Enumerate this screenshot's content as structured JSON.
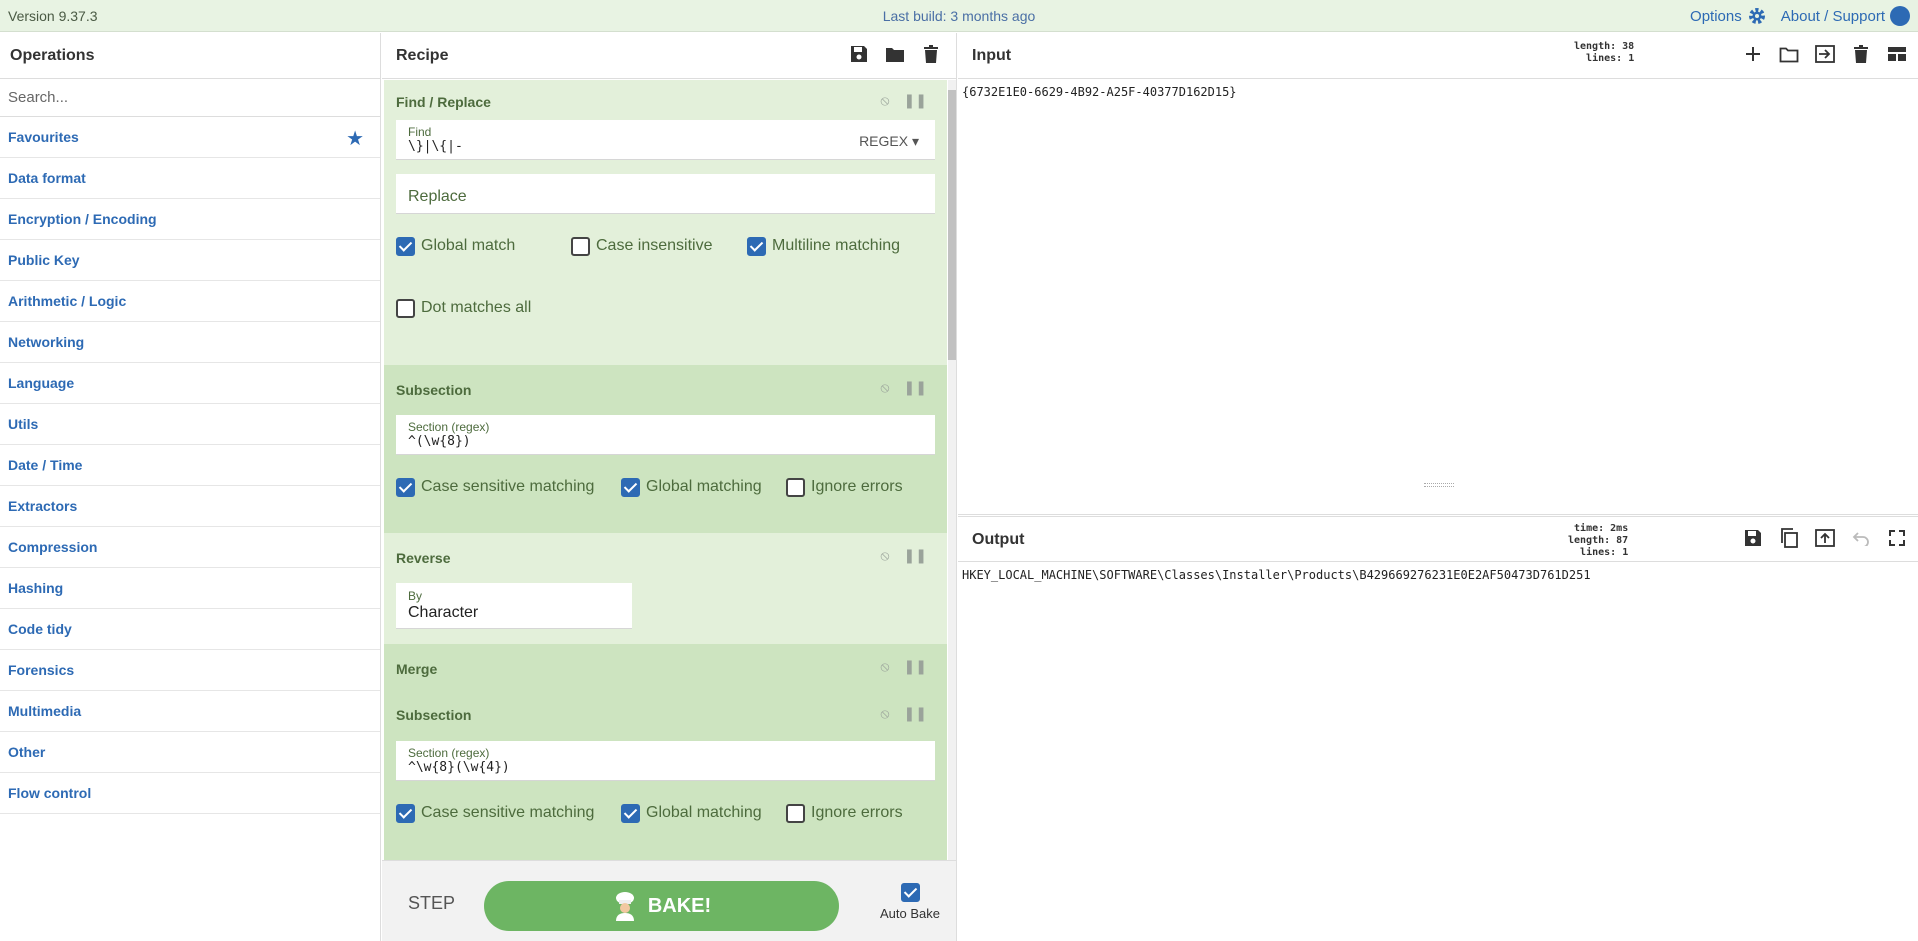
{
  "topbar": {
    "version": "Version 9.37.3",
    "build": "Last build: 3 months ago",
    "options": "Options",
    "about": "About / Support"
  },
  "operations": {
    "title": "Operations",
    "search_placeholder": "Search...",
    "categories": [
      "Favourites",
      "Data format",
      "Encryption / Encoding",
      "Public Key",
      "Arithmetic / Logic",
      "Networking",
      "Language",
      "Utils",
      "Date / Time",
      "Extractors",
      "Compression",
      "Hashing",
      "Code tidy",
      "Forensics",
      "Multimedia",
      "Other",
      "Flow control"
    ]
  },
  "recipe": {
    "title": "Recipe",
    "find_replace": {
      "title": "Find / Replace",
      "find_label": "Find",
      "find_value": "\\}|\\{|-",
      "regex_btn": "REGEX",
      "replace_placeholder": "Replace",
      "global_match": "Global match",
      "case_insensitive": "Case insensitive",
      "multiline": "Multiline matching",
      "dot_all": "Dot matches all"
    },
    "subsection1": {
      "title": "Subsection",
      "section_label": "Section (regex)",
      "section_value": "^(\\w{8})",
      "case_sensitive": "Case sensitive matching",
      "global": "Global matching",
      "ignore_errors": "Ignore errors"
    },
    "reverse": {
      "title": "Reverse",
      "by_label": "By",
      "by_value": "Character"
    },
    "merge": {
      "title": "Merge"
    },
    "subsection2": {
      "title": "Subsection",
      "section_label": "Section (regex)",
      "section_value": "^\\w{8}(\\w{4})",
      "case_sensitive": "Case sensitive matching",
      "global": "Global matching",
      "ignore_errors": "Ignore errors"
    },
    "step": "STEP",
    "bake": "BAKE!",
    "auto_bake": "Auto Bake"
  },
  "input": {
    "title": "Input",
    "stats": {
      "length": "length:  38",
      "lines": "lines:   1"
    },
    "text": "{6732E1E0-6629-4B92-A25F-40377D162D15}"
  },
  "output": {
    "title": "Output",
    "stats": {
      "time": "time:   2ms",
      "length": "length:  87",
      "lines": "lines:   1"
    },
    "text": "HKEY_LOCAL_MACHINE\\SOFTWARE\\Classes\\Installer\\Products\\B429669276231E0E2AF50473D761D251"
  },
  "colors": {
    "accent": "#2d6ab4",
    "bake": "#6db563",
    "op_bg": "#e3f0da",
    "op_bg_alt": "#cde4c0"
  }
}
